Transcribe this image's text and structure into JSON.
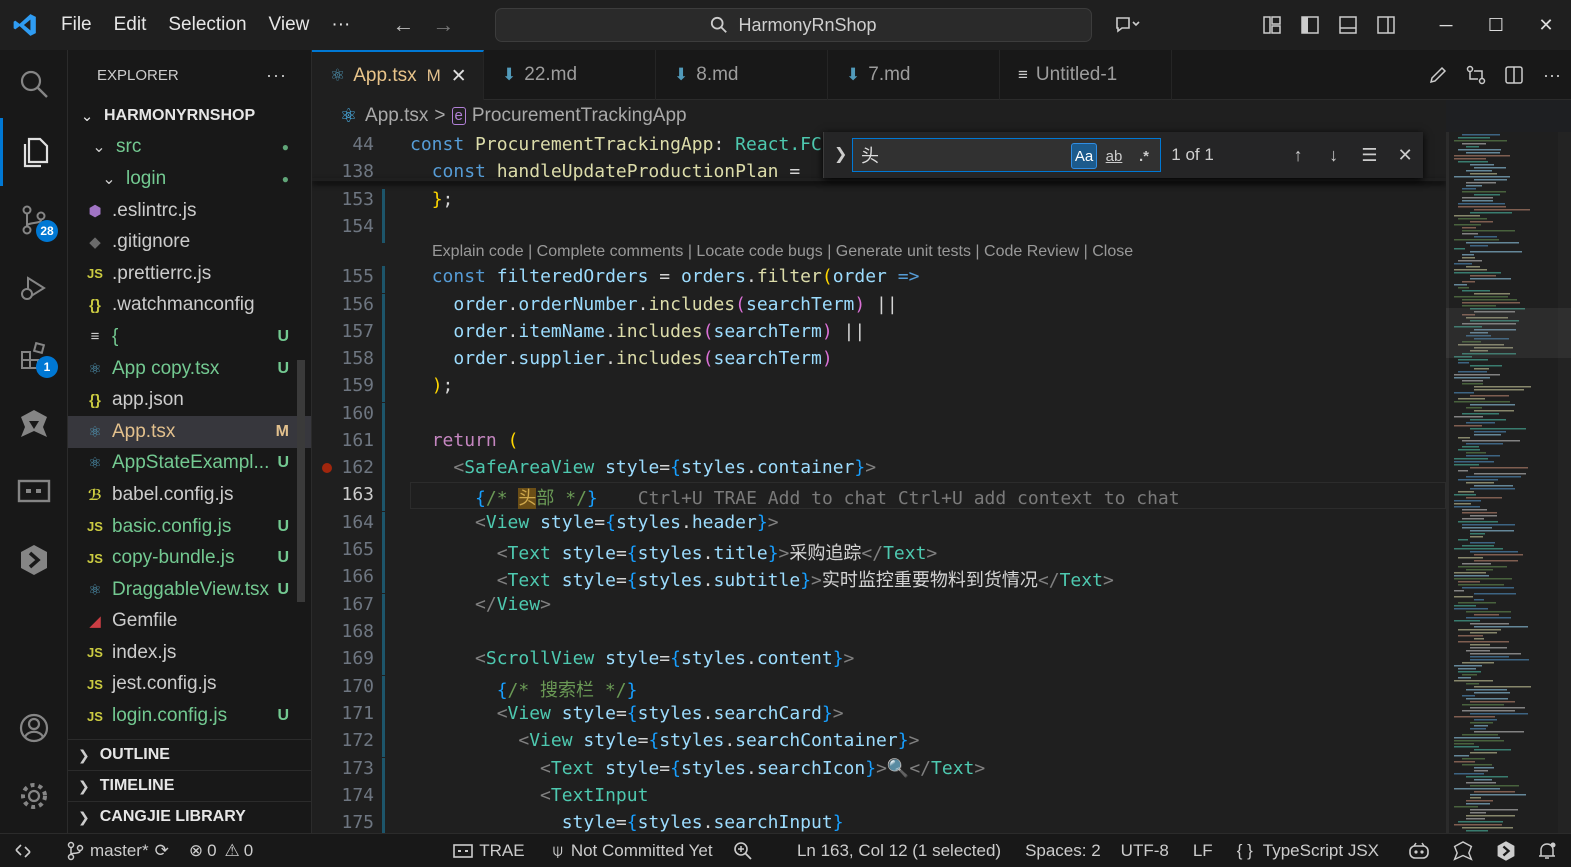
{
  "menu": {
    "file": "File",
    "edit": "Edit",
    "selection": "Selection",
    "view": "View",
    "more": "···"
  },
  "command_center": {
    "text": "HarmonyRnShop"
  },
  "explorer": {
    "title": "EXPLORER",
    "project": "HARMONYRNSHOP",
    "items": [
      {
        "label": "src",
        "icon": "chevron-down-icon",
        "status": "●",
        "color": "#73c991",
        "indent": 20
      },
      {
        "label": "login",
        "icon": "chevron-down-icon",
        "status": "●",
        "color": "#73c991",
        "indent": 30
      },
      {
        "label": ".eslintrc.js",
        "icon": "eslint-icon",
        "status": "",
        "color": "#cccccc",
        "indent": 16
      },
      {
        "label": ".gitignore",
        "icon": "git-icon",
        "status": "",
        "color": "#cccccc",
        "indent": 16
      },
      {
        "label": ".prettierrc.js",
        "icon": "js-icon",
        "status": "",
        "color": "#cccccc",
        "indent": 16
      },
      {
        "label": ".watchmanconfig",
        "icon": "json-icon",
        "status": "",
        "color": "#cccccc",
        "indent": 16
      },
      {
        "label": "{",
        "icon": "text-file-icon",
        "status": "U",
        "color": "#73c991",
        "indent": 16
      },
      {
        "label": "App copy.tsx",
        "icon": "react-icon",
        "status": "U",
        "color": "#73c991",
        "indent": 16
      },
      {
        "label": "app.json",
        "icon": "json-icon",
        "status": "",
        "color": "#cccccc",
        "indent": 16
      },
      {
        "label": "App.tsx",
        "icon": "react-icon",
        "status": "M",
        "color": "#e2c08d",
        "indent": 16
      },
      {
        "label": "AppStateExampl...",
        "icon": "react-icon",
        "status": "U",
        "color": "#73c991",
        "indent": 16
      },
      {
        "label": "babel.config.js",
        "icon": "babel-icon",
        "status": "",
        "color": "#cccccc",
        "indent": 16
      },
      {
        "label": "basic.config.js",
        "icon": "js-icon",
        "status": "U",
        "color": "#73c991",
        "indent": 16
      },
      {
        "label": "copy-bundle.js",
        "icon": "js-icon",
        "status": "U",
        "color": "#73c991",
        "indent": 16
      },
      {
        "label": "DraggableView.tsx",
        "icon": "react-icon",
        "status": "U",
        "color": "#73c991",
        "indent": 16
      },
      {
        "label": "Gemfile",
        "icon": "ruby-icon",
        "status": "",
        "color": "#cccccc",
        "indent": 16
      },
      {
        "label": "index.js",
        "icon": "js-icon",
        "status": "",
        "color": "#cccccc",
        "indent": 16
      },
      {
        "label": "jest.config.js",
        "icon": "js-icon",
        "status": "",
        "color": "#cccccc",
        "indent": 16
      },
      {
        "label": "login.config.js",
        "icon": "js-icon",
        "status": "U",
        "color": "#73c991",
        "indent": 16
      }
    ],
    "sections": [
      "OUTLINE",
      "TIMELINE",
      "CANGJIE LIBRARY"
    ]
  },
  "tabs": [
    {
      "label": "App.tsx",
      "badge": "M",
      "icon": "react-icon",
      "active": true
    },
    {
      "label": "22.md",
      "icon": "markdown-icon"
    },
    {
      "label": "8.md",
      "icon": "markdown-icon"
    },
    {
      "label": "7.md",
      "icon": "markdown-icon"
    },
    {
      "label": "Untitled-1",
      "icon": "text-file-icon"
    }
  ],
  "breadcrumb": {
    "file": "App.tsx",
    "sep": ">",
    "symbol": "ProcurementTrackingApp"
  },
  "find": {
    "value": "头",
    "case_label": "Aa",
    "word_label": "ab",
    "regex_label": ".*",
    "count": "1 of 1"
  },
  "codelens": "Explain code | Complete comments | Locate code bugs | Generate unit tests | Code Review | Close",
  "ghost_hint": "Ctrl+U TRAE Add to chat Ctrl+U add context to chat",
  "editor_lines": [
    {
      "n": "44",
      "tokens": [
        [
          "kw",
          "const "
        ],
        [
          "fn",
          "ProcurementTrackingApp"
        ],
        [
          "tx",
          ": "
        ],
        [
          "tp",
          "React.FC"
        ]
      ]
    },
    {
      "n": "138",
      "tokens": [
        [
          "tx",
          "  "
        ],
        [
          "kw",
          "const "
        ],
        [
          "fn",
          "handleUpdateProductionPlan"
        ],
        [
          "tx",
          " = "
        ]
      ]
    },
    {
      "n": "153",
      "tokens": [
        [
          "tx",
          "  "
        ],
        [
          "gold",
          "}"
        ],
        [
          "tx",
          ";"
        ]
      ]
    },
    {
      "n": "154",
      "tokens": []
    },
    {
      "n": "155",
      "tokens": [
        [
          "tx",
          "  "
        ],
        [
          "kw",
          "const "
        ],
        [
          "vr",
          "filteredOrders"
        ],
        [
          "tx",
          " = "
        ],
        [
          "vr",
          "orders"
        ],
        [
          "tx",
          "."
        ],
        [
          "fn",
          "filter"
        ],
        [
          "gold",
          "("
        ],
        [
          "vr",
          "order"
        ],
        [
          "tx",
          " "
        ],
        [
          "kw",
          "=>"
        ]
      ]
    },
    {
      "n": "156",
      "tokens": [
        [
          "tx",
          "    "
        ],
        [
          "vr",
          "order"
        ],
        [
          "tx",
          "."
        ],
        [
          "vr",
          "orderNumber"
        ],
        [
          "tx",
          "."
        ],
        [
          "fn",
          "includes"
        ],
        [
          "pn",
          "("
        ],
        [
          "vr",
          "searchTerm"
        ],
        [
          "pn",
          ")"
        ],
        [
          "tx",
          " ||"
        ]
      ]
    },
    {
      "n": "157",
      "tokens": [
        [
          "tx",
          "    "
        ],
        [
          "vr",
          "order"
        ],
        [
          "tx",
          "."
        ],
        [
          "vr",
          "itemName"
        ],
        [
          "tx",
          "."
        ],
        [
          "fn",
          "includes"
        ],
        [
          "pn",
          "("
        ],
        [
          "vr",
          "searchTerm"
        ],
        [
          "pn",
          ")"
        ],
        [
          "tx",
          " ||"
        ]
      ]
    },
    {
      "n": "158",
      "tokens": [
        [
          "tx",
          "    "
        ],
        [
          "vr",
          "order"
        ],
        [
          "tx",
          "."
        ],
        [
          "vr",
          "supplier"
        ],
        [
          "tx",
          "."
        ],
        [
          "fn",
          "includes"
        ],
        [
          "pn",
          "("
        ],
        [
          "vr",
          "searchTerm"
        ],
        [
          "pn",
          ")"
        ]
      ]
    },
    {
      "n": "159",
      "tokens": [
        [
          "tx",
          "  "
        ],
        [
          "gold",
          ")"
        ],
        [
          "tx",
          ";"
        ]
      ]
    },
    {
      "n": "160",
      "tokens": []
    },
    {
      "n": "161",
      "tokens": [
        [
          "tx",
          "  "
        ],
        [
          "kw2",
          "return"
        ],
        [
          "tx",
          " "
        ],
        [
          "gold",
          "("
        ]
      ]
    },
    {
      "n": "162",
      "tokens": [
        [
          "tx",
          "    "
        ],
        [
          "tg",
          "<"
        ],
        [
          "jsx",
          "SafeAreaView"
        ],
        [
          "tx",
          " "
        ],
        [
          "vr",
          "style"
        ],
        [
          "tx",
          "="
        ],
        [
          "br",
          "{"
        ],
        [
          "vr",
          "styles"
        ],
        [
          "tx",
          "."
        ],
        [
          "vr",
          "container"
        ],
        [
          "br",
          "}"
        ],
        [
          "tg",
          ">"
        ]
      ]
    },
    {
      "n": "163",
      "tokens": [
        [
          "tx",
          "      "
        ],
        [
          "br",
          "{"
        ],
        [
          "cm",
          "/* "
        ],
        [
          "hl",
          "头"
        ],
        [
          "cm",
          "部 */"
        ],
        [
          "br",
          "}"
        ]
      ],
      "ghost": true,
      "current": true
    },
    {
      "n": "164",
      "tokens": [
        [
          "tx",
          "      "
        ],
        [
          "tg",
          "<"
        ],
        [
          "jsx",
          "View"
        ],
        [
          "tx",
          " "
        ],
        [
          "vr",
          "style"
        ],
        [
          "tx",
          "="
        ],
        [
          "br",
          "{"
        ],
        [
          "vr",
          "styles"
        ],
        [
          "tx",
          "."
        ],
        [
          "vr",
          "header"
        ],
        [
          "br",
          "}"
        ],
        [
          "tg",
          ">"
        ]
      ]
    },
    {
      "n": "165",
      "tokens": [
        [
          "tx",
          "        "
        ],
        [
          "tg",
          "<"
        ],
        [
          "jsx",
          "Text"
        ],
        [
          "tx",
          " "
        ],
        [
          "vr",
          "style"
        ],
        [
          "tx",
          "="
        ],
        [
          "br",
          "{"
        ],
        [
          "vr",
          "styles"
        ],
        [
          "tx",
          "."
        ],
        [
          "vr",
          "title"
        ],
        [
          "br",
          "}"
        ],
        [
          "tg",
          ">"
        ],
        [
          "tx",
          "采购追踪"
        ],
        [
          "tg",
          "</"
        ],
        [
          "jsx",
          "Text"
        ],
        [
          "tg",
          ">"
        ]
      ]
    },
    {
      "n": "166",
      "tokens": [
        [
          "tx",
          "        "
        ],
        [
          "tg",
          "<"
        ],
        [
          "jsx",
          "Text"
        ],
        [
          "tx",
          " "
        ],
        [
          "vr",
          "style"
        ],
        [
          "tx",
          "="
        ],
        [
          "br",
          "{"
        ],
        [
          "vr",
          "styles"
        ],
        [
          "tx",
          "."
        ],
        [
          "vr",
          "subtitle"
        ],
        [
          "br",
          "}"
        ],
        [
          "tg",
          ">"
        ],
        [
          "tx",
          "实时监控重要物料到货情况"
        ],
        [
          "tg",
          "</"
        ],
        [
          "jsx",
          "Text"
        ],
        [
          "tg",
          ">"
        ]
      ]
    },
    {
      "n": "167",
      "tokens": [
        [
          "tx",
          "      "
        ],
        [
          "tg",
          "</"
        ],
        [
          "jsx",
          "View"
        ],
        [
          "tg",
          ">"
        ]
      ]
    },
    {
      "n": "168",
      "tokens": []
    },
    {
      "n": "169",
      "tokens": [
        [
          "tx",
          "      "
        ],
        [
          "tg",
          "<"
        ],
        [
          "jsx",
          "ScrollView"
        ],
        [
          "tx",
          " "
        ],
        [
          "vr",
          "style"
        ],
        [
          "tx",
          "="
        ],
        [
          "br",
          "{"
        ],
        [
          "vr",
          "styles"
        ],
        [
          "tx",
          "."
        ],
        [
          "vr",
          "content"
        ],
        [
          "br",
          "}"
        ],
        [
          "tg",
          ">"
        ]
      ]
    },
    {
      "n": "170",
      "tokens": [
        [
          "tx",
          "        "
        ],
        [
          "br",
          "{"
        ],
        [
          "cm",
          "/* 搜索栏 */"
        ],
        [
          "br",
          "}"
        ]
      ]
    },
    {
      "n": "171",
      "tokens": [
        [
          "tx",
          "        "
        ],
        [
          "tg",
          "<"
        ],
        [
          "jsx",
          "View"
        ],
        [
          "tx",
          " "
        ],
        [
          "vr",
          "style"
        ],
        [
          "tx",
          "="
        ],
        [
          "br",
          "{"
        ],
        [
          "vr",
          "styles"
        ],
        [
          "tx",
          "."
        ],
        [
          "vr",
          "searchCard"
        ],
        [
          "br",
          "}"
        ],
        [
          "tg",
          ">"
        ]
      ]
    },
    {
      "n": "172",
      "tokens": [
        [
          "tx",
          "          "
        ],
        [
          "tg",
          "<"
        ],
        [
          "jsx",
          "View"
        ],
        [
          "tx",
          " "
        ],
        [
          "vr",
          "style"
        ],
        [
          "tx",
          "="
        ],
        [
          "br",
          "{"
        ],
        [
          "vr",
          "styles"
        ],
        [
          "tx",
          "."
        ],
        [
          "vr",
          "searchContainer"
        ],
        [
          "br",
          "}"
        ],
        [
          "tg",
          ">"
        ]
      ]
    },
    {
      "n": "173",
      "tokens": [
        [
          "tx",
          "            "
        ],
        [
          "tg",
          "<"
        ],
        [
          "jsx",
          "Text"
        ],
        [
          "tx",
          " "
        ],
        [
          "vr",
          "style"
        ],
        [
          "tx",
          "="
        ],
        [
          "br",
          "{"
        ],
        [
          "vr",
          "styles"
        ],
        [
          "tx",
          "."
        ],
        [
          "vr",
          "searchIcon"
        ],
        [
          "br",
          "}"
        ],
        [
          "tg",
          ">"
        ],
        [
          "tx",
          "🔍"
        ],
        [
          "tg",
          "</"
        ],
        [
          "jsx",
          "Text"
        ],
        [
          "tg",
          ">"
        ]
      ]
    },
    {
      "n": "174",
      "tokens": [
        [
          "tx",
          "            "
        ],
        [
          "tg",
          "<"
        ],
        [
          "jsx",
          "TextInput"
        ]
      ]
    },
    {
      "n": "175",
      "tokens": [
        [
          "tx",
          "              "
        ],
        [
          "vr",
          "style"
        ],
        [
          "tx",
          "="
        ],
        [
          "br",
          "{"
        ],
        [
          "vr",
          "styles"
        ],
        [
          "tx",
          "."
        ],
        [
          "vr",
          "searchInput"
        ],
        [
          "br",
          "}"
        ]
      ]
    }
  ],
  "status": {
    "branch": "master*",
    "errors": "0",
    "warnings": "0",
    "trae": "TRAE",
    "commit": "Not Committed Yet",
    "position": "Ln 163, Col 12 (1 selected)",
    "spaces": "Spaces: 2",
    "encoding": "UTF-8",
    "eol": "LF",
    "language": "TypeScript JSX"
  },
  "activity_badges": {
    "scm": "28",
    "extensions": "1"
  },
  "colors": {
    "accent": "#0078d4",
    "modified": "#e2c08d",
    "untracked": "#73c991"
  }
}
